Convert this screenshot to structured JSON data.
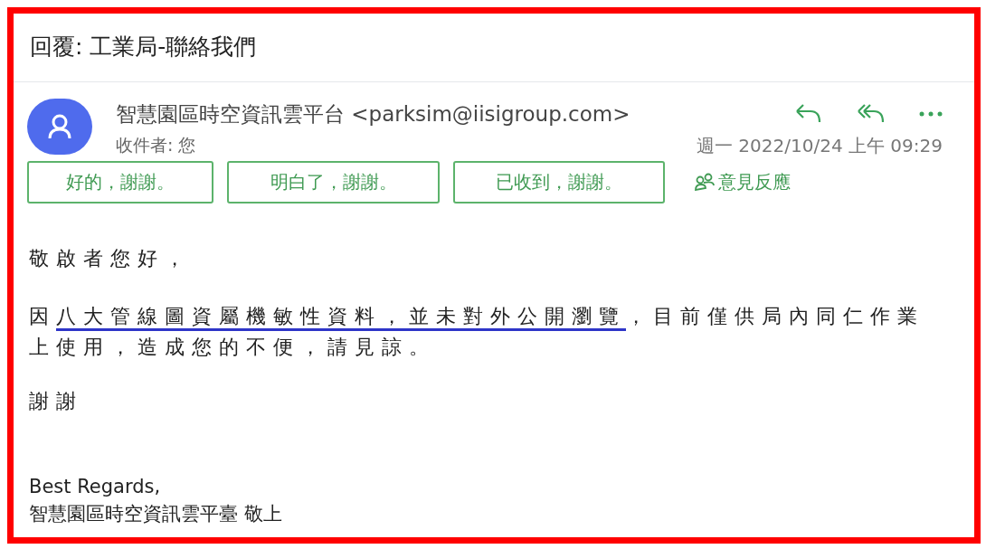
{
  "title": "回覆: 工業局-聯絡我們",
  "message": {
    "sender": "智慧園區時空資訊雲平台 <parksim@iisigroup.com>",
    "recipient": "收件者: 您",
    "date": "週一 2022/10/24 上午 09:29"
  },
  "quick_replies": [
    "好的，謝謝。",
    "明白了，謝謝。",
    "已收到，謝謝。"
  ],
  "feedback_link": "意見反應",
  "body": [
    {
      "parts": [
        {
          "text": "敬啟者您好，",
          "underlined": false
        }
      ]
    },
    {
      "parts": [
        {
          "text": "因",
          "underlined": false
        },
        {
          "text": "八大管線圖資屬機敏性資料，並未對外公開瀏覽",
          "underlined": true
        },
        {
          "text": "，目前僅供局內同仁作業上使用，造成您的不便，請見諒。",
          "underlined": false
        }
      ]
    },
    {
      "parts": [
        {
          "text": "謝謝",
          "underlined": false
        }
      ]
    }
  ],
  "signature": [
    "Best Regards,",
    "智慧園區時空資訊雲平臺 敬上"
  ]
}
